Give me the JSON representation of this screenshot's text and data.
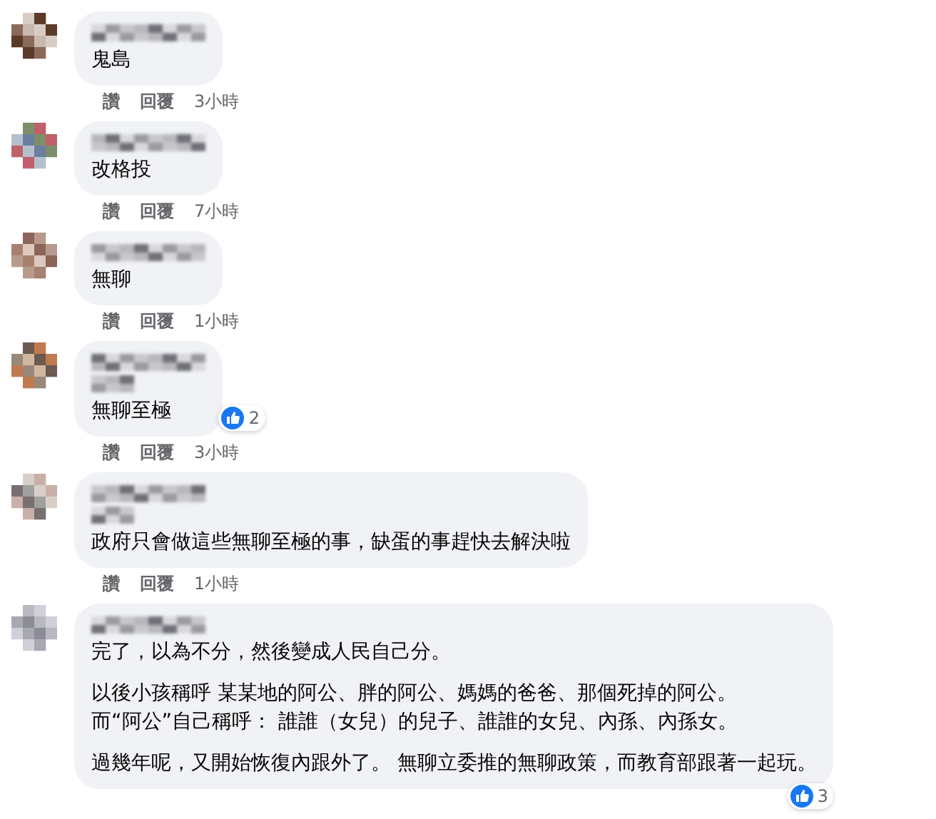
{
  "comments": [
    {
      "kind": "plain",
      "paragraphs": [
        [
          "鬼島"
        ]
      ],
      "actions": [
        "讚",
        "回覆"
      ],
      "time": "3小時"
    },
    {
      "kind": "plain",
      "paragraphs": [
        [
          "改格投"
        ]
      ],
      "actions": [
        "讚",
        "回覆"
      ],
      "time": "7小時"
    },
    {
      "kind": "plain",
      "paragraphs": [
        [
          "無聊"
        ]
      ],
      "actions": [
        "讚",
        "回覆"
      ],
      "time": "1小時"
    },
    {
      "kind": "badged",
      "paragraphs": [
        [
          "無聊至極"
        ]
      ],
      "reactions": "2",
      "actions": [
        "讚",
        "回覆"
      ],
      "time": "3小時"
    },
    {
      "kind": "badged",
      "paragraphs": [
        [
          "政府只會做這些無聊至極的事，缺蛋的事趕快去解決啦"
        ]
      ],
      "actions": [
        "讚",
        "回覆"
      ],
      "time": "1小時"
    },
    {
      "kind": "plain",
      "paragraphs": [
        [
          "完了，以為不分，然後變成人民自己分。"
        ],
        [
          "以後小孩稱呼 某某地的阿公、胖的阿公、媽媽的爸爸、那個死掉的阿公。",
          "而“阿公”自己稱呼： 誰誰（女兒）的兒子、誰誰的女兒、內孫、內孫女。"
        ],
        [
          "過幾年呢，又開始恢復內跟外了。 無聊立委推的無聊政策，而教育部跟著一起玩。"
        ]
      ],
      "reactions": "3"
    }
  ]
}
